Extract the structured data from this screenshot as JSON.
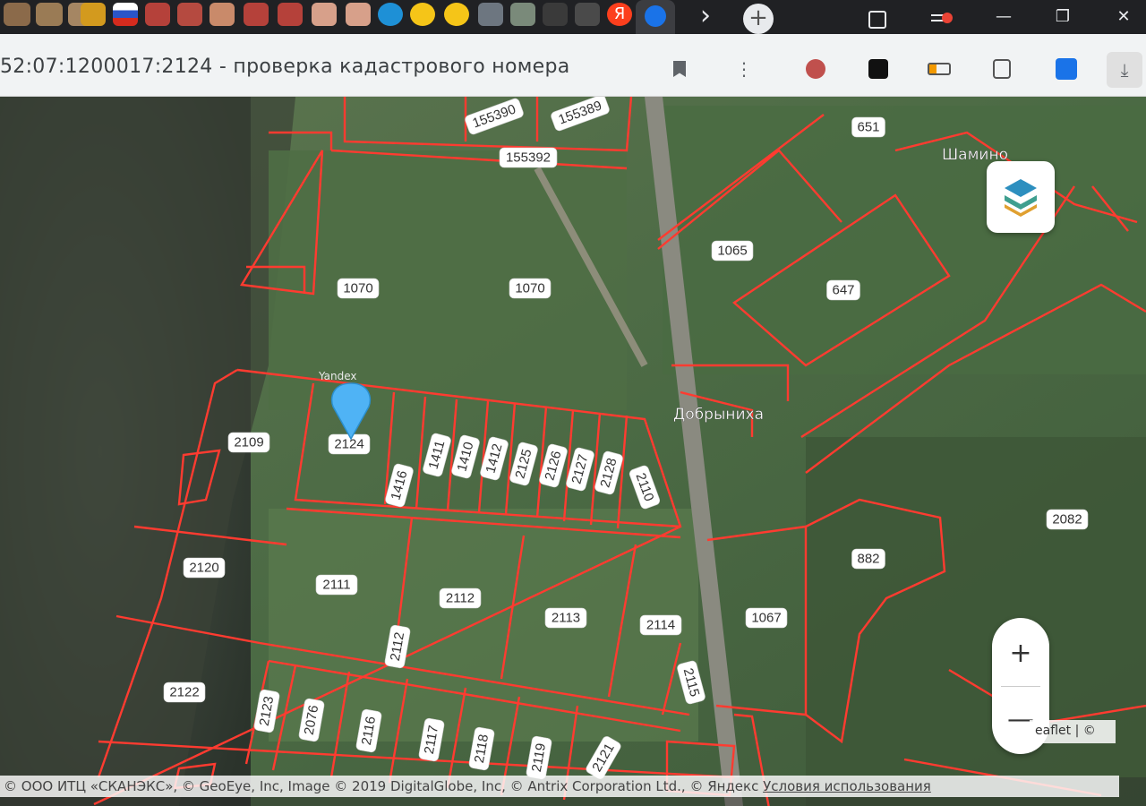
{
  "browser": {
    "tab_icons": [
      "gov-seal-icon",
      "gov-seal-icon",
      "gov-seal-icon",
      "bookmark-icon",
      "flag-icon",
      "gov-seal-icon",
      "gov-seal-icon",
      "doc-icon",
      "gov-seal-icon",
      "gov-seal-icon",
      "doc-icon",
      "doc-icon",
      "globe-icon",
      "beeline-icon",
      "beeline-icon",
      "bank-icon",
      "doc-icon",
      "app-icon",
      "app-icon",
      "yandex-icon"
    ],
    "yandex_glyph": "Я",
    "new_tab_glyph": "+",
    "next_glyph": "›",
    "window_controls": {
      "minimize": "—",
      "restore": "❐",
      "close": "✕"
    }
  },
  "page": {
    "title": "52:07:1200017:2124 - проверка кадастрового номера"
  },
  "map": {
    "plots": [
      "155390",
      "155389",
      "155392",
      "651",
      "1065",
      "647",
      "1070",
      "1070",
      "2109",
      "2124",
      "1416",
      "1411",
      "1410",
      "1412",
      "2125",
      "2126",
      "2127",
      "2128",
      "2110",
      "2120",
      "2111",
      "2112",
      "2113",
      "2114",
      "2112",
      "2115",
      "1067",
      "882",
      "2082",
      "2122",
      "2123",
      "2076",
      "2116",
      "2117",
      "2118",
      "2119",
      "2121"
    ],
    "places": [
      "Добрыниха",
      "Шамино"
    ],
    "pin_label": "Yandex",
    "zoom_in": "+",
    "zoom_out": "—",
    "leaflet_attr": "eaflet | ©",
    "attribution": "© ООО ИТЦ «СКАНЭКС», © GeoEye, Inc, Image © 2019 DigitalGlobe, Inc, © Antrix Corporation Ltd., © Яндекс ",
    "terms": "Условия использования"
  },
  "colors": {
    "plot_border": "#ff3b30",
    "pin": "#4fb3f5",
    "layers_top": "#2d8fbf",
    "layers_bottom": "#e0a030"
  }
}
